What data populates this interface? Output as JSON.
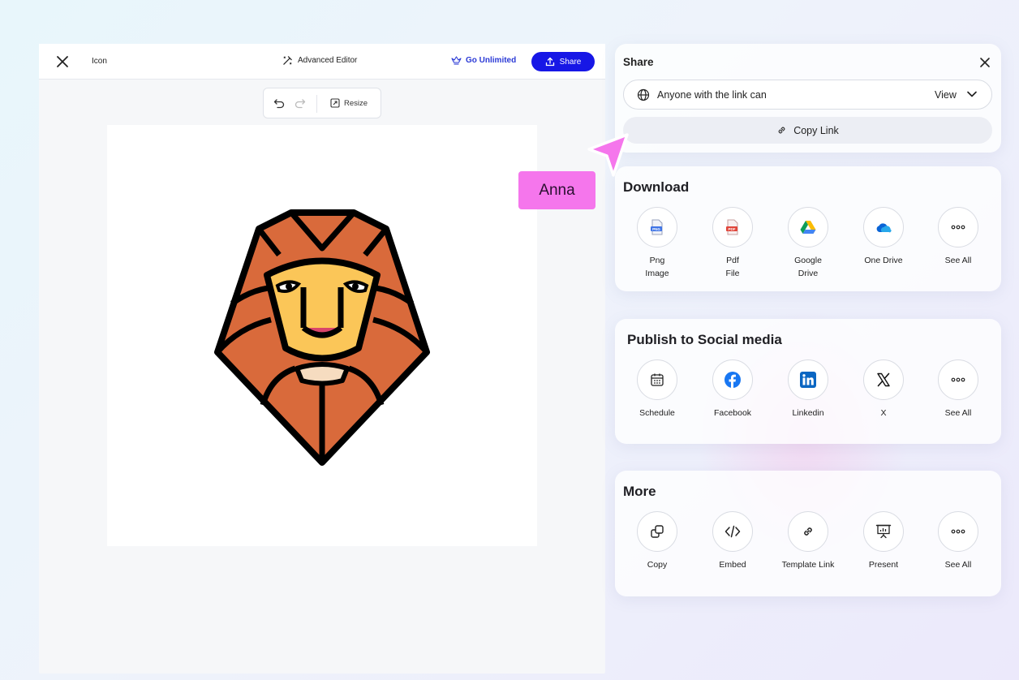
{
  "editor": {
    "doc_name": "Icon",
    "advanced_editor_label": "Advanced Editor",
    "go_unlimited_label": "Go Unlimited",
    "share_button_label": "Share",
    "resize_label": "Resize"
  },
  "share": {
    "title": "Share",
    "access_text": "Anyone with the link can",
    "access_value": "View",
    "copy_link_label": "Copy Link"
  },
  "download": {
    "title": "Download",
    "items": [
      {
        "label": "Png\nImage",
        "icon": "png-file-icon"
      },
      {
        "label": "Pdf\nFile",
        "icon": "pdf-file-icon"
      },
      {
        "label": "Google\nDrive",
        "icon": "google-drive-icon"
      },
      {
        "label": "One Drive",
        "icon": "onedrive-icon"
      },
      {
        "label": "See All",
        "icon": "more-icon"
      }
    ]
  },
  "social": {
    "title": "Publish to Social media",
    "items": [
      {
        "label": "Schedule",
        "icon": "calendar-icon"
      },
      {
        "label": "Facebook",
        "icon": "facebook-icon"
      },
      {
        "label": "Linkedin",
        "icon": "linkedin-icon"
      },
      {
        "label": "X",
        "icon": "x-icon"
      },
      {
        "label": "See All",
        "icon": "more-icon"
      }
    ]
  },
  "more": {
    "title": "More",
    "items": [
      {
        "label": "Copy",
        "icon": "copy-icon"
      },
      {
        "label": "Embed",
        "icon": "code-icon"
      },
      {
        "label": "Template Link",
        "icon": "link-icon"
      },
      {
        "label": "Present",
        "icon": "presentation-icon"
      },
      {
        "label": "See All",
        "icon": "more-icon"
      }
    ]
  },
  "cursor": {
    "user_name": "Anna",
    "color": "#f576ec"
  },
  "colors": {
    "primary": "#1717e6",
    "lion_mane": "#d96a3b",
    "lion_face": "#fbc658",
    "lion_nose": "#d9456a"
  }
}
